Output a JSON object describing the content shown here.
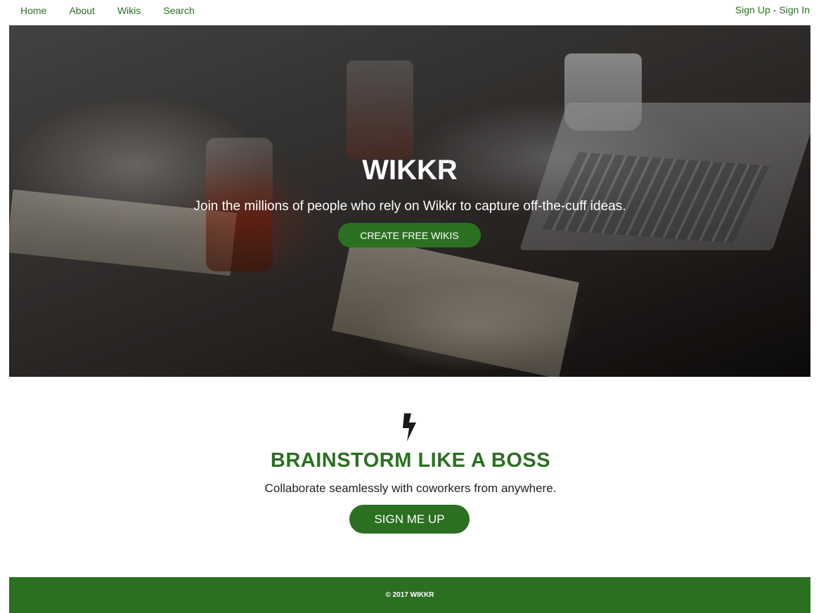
{
  "nav": {
    "links": [
      "Home",
      "About",
      "Wikis",
      "Search"
    ],
    "signup": "Sign Up",
    "separator": "-",
    "signin": "Sign In"
  },
  "hero": {
    "title": "WIKKR",
    "subtitle": "Join the millions of people who rely on Wikkr to capture off-the-cuff ideas.",
    "cta": "CREATE FREE WIKIS"
  },
  "feature": {
    "icon": "lightning-bolt-icon",
    "title": "BRAINSTORM LIKE A BOSS",
    "subtitle": "Collaborate seamlessly with coworkers from anywhere.",
    "cta": "SIGN ME UP"
  },
  "footer": {
    "text": "© 2017 WIKKR"
  },
  "colors": {
    "brand_green": "#2a7020",
    "text": "#222222",
    "background": "#ffffff"
  }
}
